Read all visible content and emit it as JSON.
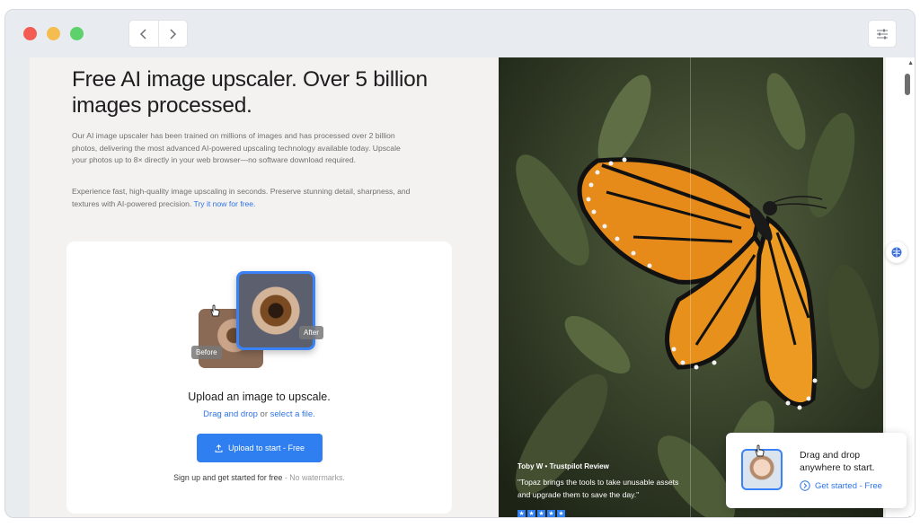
{
  "browser": {
    "back_icon": "chevron-left-icon",
    "forward_icon": "chevron-right-icon",
    "settings_icon": "sliders-icon"
  },
  "hero": {
    "title": "Free AI image upscaler. Over 5 billion images processed.",
    "para1": "Our AI image upscaler has been trained on millions of images and has processed over 2 billion photos, delivering the most advanced AI-powered upscaling technology available today. Upscale your photos up to 8× directly in your web browser—no software download required.",
    "para2_text": "Experience fast, high-quality image upscaling in seconds. Preserve stunning detail, sharpness, and textures with AI-powered precision.",
    "para2_link": "Try it now for free."
  },
  "upload_card": {
    "before_label": "Before",
    "after_label": "After",
    "title": "Upload an image to upscale.",
    "drag_link": "Drag and drop",
    "or_text": "or",
    "select_link": "select a file.",
    "button_label": "Upload to start - Free",
    "note_main": "Sign up and get started for free",
    "note_muted": "- No watermarks."
  },
  "review": {
    "author": "Toby W",
    "separator": "•",
    "source": "Trustpilot Review",
    "quote": "\"Topaz brings the tools to take unusable assets and upgrade them to save the day.\"",
    "stars": 5
  },
  "toast": {
    "title": "Drag and drop anywhere to start.",
    "link": "Get started - Free"
  },
  "colors": {
    "accent": "#2f7ff0",
    "link": "#2f74e6",
    "pane_bg": "#f3f2f1"
  }
}
